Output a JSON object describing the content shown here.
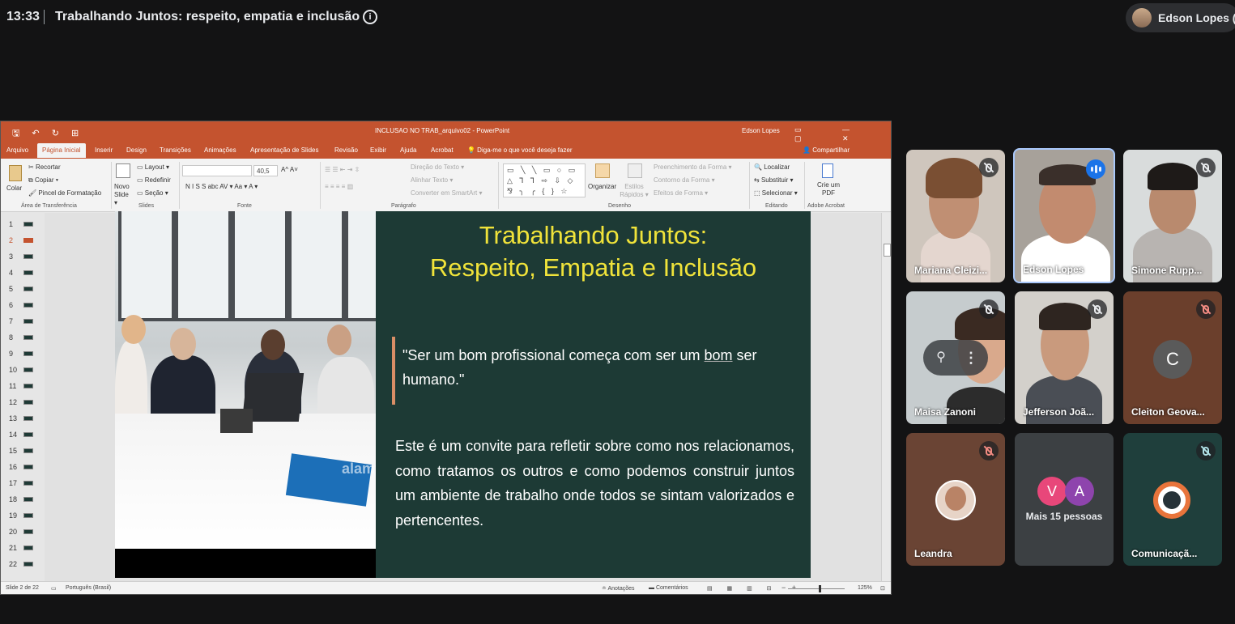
{
  "meeting": {
    "time": "13:33",
    "title": "Trabalhando Juntos: respeito, empatia e inclusão",
    "presenter_chip": "Edson Lopes (A"
  },
  "powerpoint": {
    "quick_access": "🖫 ↶ ↻ ⊞",
    "doc_title": "INCLUSAO NO TRAB_arquivo02 - PowerPoint",
    "user": "Edson Lopes",
    "window_controls": "▭ — ▢ ✕",
    "tabs": [
      "Arquivo",
      "Página Inicial",
      "Inserir",
      "Design",
      "Transições",
      "Animações",
      "Apresentação de Slides",
      "Revisão",
      "Exibir",
      "Ajuda",
      "Acrobat",
      "💡 Diga-me o que você deseja fazer"
    ],
    "share": "Compartilhar",
    "ribbon": {
      "recortar": "Recortar",
      "copiar": "Copiar ▾",
      "pincel": "Pincel de Formatação",
      "colar": "Colar",
      "novo_slide": "Novo Slide ▾",
      "layout": "Layout ▾",
      "redefinir": "Redefinir",
      "secao": "Seção ▾",
      "font_size": "40,5",
      "font_buttons": "A^ A˅",
      "format_buttons": "N  I  S  S  abc  AV ▾  Aa ▾   A ▾",
      "direcao": "Direção do Texto ▾",
      "alinhar": "Alinhar Texto ▾",
      "converter": "Converter em SmartArt ▾",
      "shapes_row1": "▭ ╲ ╲ ▭ ○ ▭",
      "shapes_row2": "△ ⅂ ⅂ ⇨ ⇩ ◇",
      "shapes_row3": "⅋ ╮ ╭ { } ☆",
      "organizar": "Organizar",
      "estilos": "Estilos Rápidos ▾",
      "preenchimento": "Preenchimento da Forma ▾",
      "contorno": "Contorno da Forma ▾",
      "efeitos": "Efeitos de Forma ▾",
      "localizar": "Localizar",
      "substituir": "Substituir ▾",
      "selecionar": "Selecionar ▾",
      "crie_pdf": "Crie um PDF",
      "groups": {
        "clipboard": "Área de Transferência",
        "slides": "Slides",
        "fonte": "Fonte",
        "paragrafo": "Parágrafo",
        "desenho": "Desenho",
        "editando": "Editando",
        "adobe": "Adobe Acrobat"
      }
    },
    "thumbnails": [
      "1",
      "2",
      "3",
      "4",
      "5",
      "6",
      "7",
      "8",
      "9",
      "10",
      "11",
      "12",
      "13",
      "14",
      "15",
      "16",
      "17",
      "18",
      "19",
      "20",
      "21",
      "22"
    ],
    "selected_slide": 2,
    "slide": {
      "title_line1": "Trabalhando Juntos:",
      "title_line2": "Respeito, Empatia e Inclusão",
      "quote_part1": "\"Ser um bom profissional começa com ser um ",
      "quote_underlined": "bom",
      "quote_part2": " ser humano.\"",
      "body": "Este é um convite para refletir sobre como nos relacionamos, como tratamos os outros e como podemos construir juntos um ambiente de trabalho onde todos se sintam valorizados e pertencentes.",
      "photo_watermark": "alamy"
    },
    "status": {
      "slide_count": "Slide 2 de 22",
      "language": "Português (Brasil)",
      "notes": "Anotações",
      "comments": "Comentários",
      "view_icons": "▤ ▦ ▥ ⊟",
      "zoom_controls": "−   +",
      "zoom": "125%"
    }
  },
  "participants": [
    {
      "name": "Mariana Cleizi...",
      "muted": true
    },
    {
      "name": "Edson Lopes",
      "speaking": true
    },
    {
      "name": "Simone Rupp...",
      "muted": true
    },
    {
      "name": "Maisa Zanoni",
      "muted": true
    },
    {
      "name": "Jefferson Joã...",
      "muted": true
    },
    {
      "name": "Cleiton Geova...",
      "initial": "C",
      "muted": true
    },
    {
      "name": "Leandra",
      "muted": true
    },
    {
      "name": "Mais 15 pessoas",
      "bubbles": [
        "V",
        "A"
      ]
    },
    {
      "name": "Comunicaçã...",
      "muted": true
    }
  ],
  "colors": {
    "ppt_accent": "#c4532f",
    "slide_bg": "#1d3a35",
    "slide_title": "#f0e33a",
    "meet_bg": "#131314",
    "speaking_border": "#a8c7fa"
  },
  "icons": {
    "info": "ⓘ",
    "pin": "📌",
    "more": "⋮"
  }
}
